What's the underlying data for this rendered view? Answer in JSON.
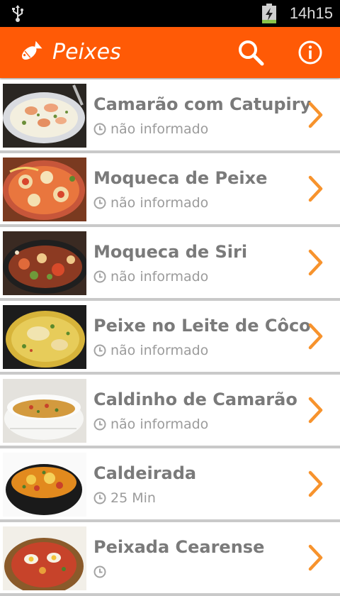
{
  "status_bar": {
    "time": "14h15",
    "icons": [
      "usb-icon",
      "battery-charging-icon"
    ]
  },
  "action_bar": {
    "title": "Peixes",
    "icons": [
      "fish-icon",
      "search-icon",
      "info-icon"
    ]
  },
  "colors": {
    "accent": "#ff5a06",
    "chevron": "#f7932d",
    "title_text": "#7a7a7a",
    "time_text": "#9b9b9b"
  },
  "recipes": [
    {
      "name": "Camarão com Catupiry",
      "time": "não informado"
    },
    {
      "name": "Moqueca de Peixe",
      "time": "não informado"
    },
    {
      "name": "Moqueca de Siri",
      "time": "não informado"
    },
    {
      "name": "Peixe no Leite de Côco",
      "time": "não informado"
    },
    {
      "name": "Caldinho de Camarão",
      "time": "não informado"
    },
    {
      "name": "Caldeirada",
      "time": "25 Min"
    },
    {
      "name": "Peixada Cearense",
      "time": ""
    }
  ]
}
